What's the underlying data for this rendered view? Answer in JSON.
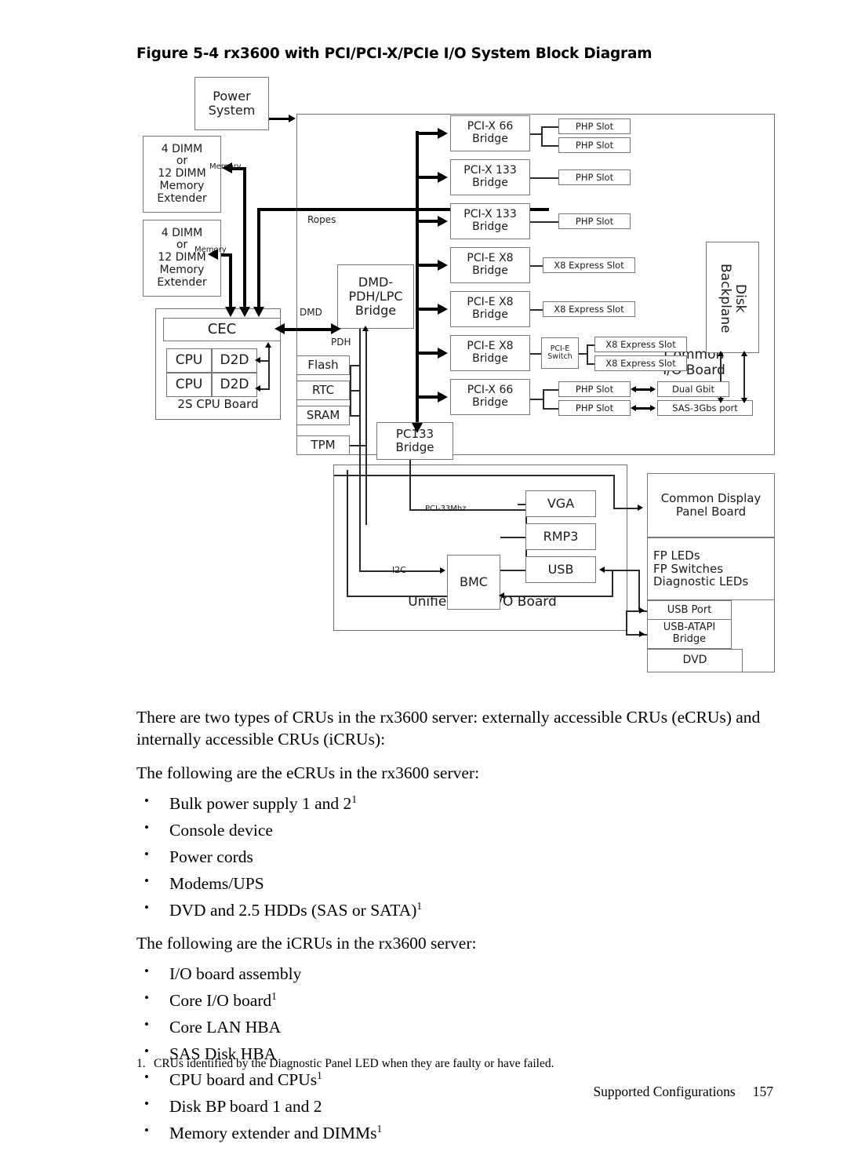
{
  "figure": {
    "title": "Figure  5-4  rx3600 with PCI/PCI-X/PCIe I/O System Block Diagram"
  },
  "diagram": {
    "power_system": "Power\nSystem",
    "mem_ext_1": "4 DIMM\nor\n12 DIMM\nMemory\nExtender",
    "mem_ext_2": "4 DIMM\nor\n12 DIMM\nMemory\nExtender",
    "cec": "CEC",
    "cpu_1": "CPU",
    "d2d_1": "D2D",
    "cpu_2": "CPU",
    "d2d_2": "D2D",
    "cpu_board_label": "2S CPU Board",
    "dmd_pdh_lpc": "DMD-\nPDH/LPC\nBridge",
    "flash": "Flash",
    "rtc": "RTC",
    "sram": "SRAM",
    "tpm": "TPM",
    "pc133_bridge": "PC133\nBridge",
    "common_io_board": "Common\nI/O Board",
    "unified_core_io_board": "Unified Core I/O Board",
    "disk_backplane": "Disk Backplane",
    "bmc": "BMC",
    "vga": "VGA",
    "rmp3": "RMP3",
    "usb": "USB",
    "common_display_panel": "Common Display\nPanel Board",
    "fp_items": "FP LEDs\nFP Switches\nDiagnostic LEDs",
    "usb_port": "USB Port",
    "usb_atapi_bridge": "USB-ATAPI\nBridge",
    "dvd": "DVD",
    "dual_gbit": "Dual Gbit",
    "sas_port": "SAS-3Gbs port",
    "pcie_switch": "PCI-E\nSwitch",
    "bridges": [
      {
        "name": "PCI-X 66\nBridge",
        "slots": [
          "PHP Slot",
          "PHP Slot"
        ]
      },
      {
        "name": "PCI-X 133\nBridge",
        "slots": [
          "PHP Slot"
        ]
      },
      {
        "name": "PCI-X 133\nBridge",
        "slots": [
          "PHP Slot"
        ]
      },
      {
        "name": "PCI-E X8\nBridge",
        "slots": [
          "X8 Express Slot"
        ]
      },
      {
        "name": "PCI-E X8\nBridge",
        "slots": [
          "X8 Express Slot"
        ]
      },
      {
        "name": "PCI-E X8\nBridge",
        "slots": [
          "X8 Express Slot",
          "X8 Express Slot"
        ]
      },
      {
        "name": "PCI-X 66\nBridge",
        "slots": [
          "PHP Slot",
          "PHP Slot"
        ]
      }
    ],
    "tags": {
      "memory_1": "Memory",
      "memory_2": "Memory",
      "ropes": "Ropes",
      "dmd": "DMD",
      "pdh": "PDH",
      "pci_33mhz": "PCI-33Mhz",
      "i2c": "I2C"
    }
  },
  "text": {
    "intro": "There are two types of CRUs in the rx3600 server: externally accessible CRUs (eCRUs) and internally accessible CRUs (iCRUs):",
    "ecru_lead": "The following are the eCRUs in the rx3600 server:",
    "ecru_items": [
      {
        "text": "Bulk power supply 1 and 2",
        "note": "1"
      },
      {
        "text": "Console device",
        "note": ""
      },
      {
        "text": "Power cords",
        "note": ""
      },
      {
        "text": "Modems/UPS",
        "note": ""
      },
      {
        "text": "DVD and 2.5 HDDs (SAS or SATA)",
        "note": "1"
      }
    ],
    "icru_lead": "The following are the iCRUs in the rx3600 server:",
    "icru_items": [
      {
        "text": "I/O board assembly",
        "note": ""
      },
      {
        "text": "Core I/O board",
        "note": "1"
      },
      {
        "text": "Core LAN HBA",
        "note": ""
      },
      {
        "text": "SAS Disk HBA",
        "note": ""
      },
      {
        "text": "CPU board and CPUs",
        "note": "1"
      },
      {
        "text": "Disk BP board 1 and 2",
        "note": ""
      },
      {
        "text": "Memory extender and DIMMs",
        "note": "1"
      }
    ],
    "footnote_num": "1.",
    "footnote": "CRUs identified by the Diagnostic Panel LED when they are faulty or have failed."
  },
  "footer": {
    "section": "Supported Configurations",
    "page": "157"
  }
}
